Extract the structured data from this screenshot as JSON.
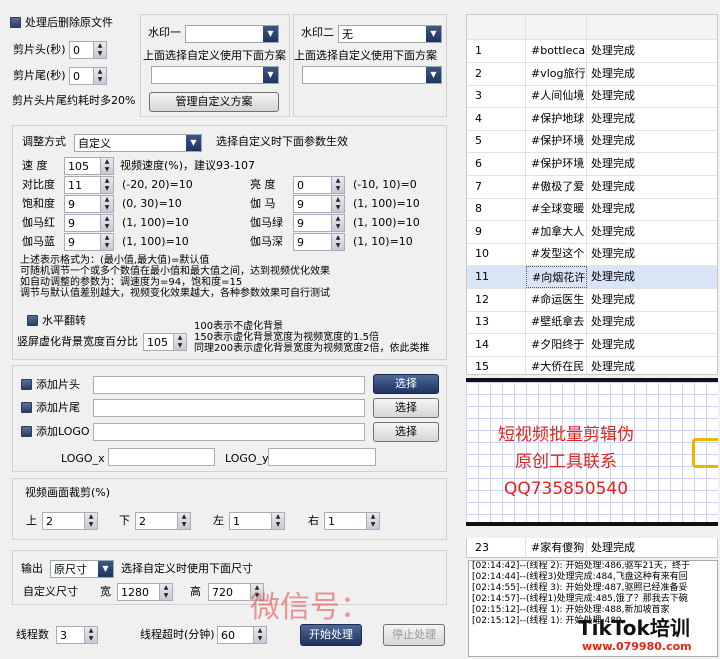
{
  "options": {
    "delete_original_label": "处理后删除原文件",
    "trim_head_label": "剪片头(秒)",
    "trim_head_value": "0",
    "trim_tail_label": "剪片尾(秒)",
    "trim_tail_value": "0",
    "trim_note": "剪片头片尾约耗时多20%"
  },
  "watermark1": {
    "label": "水印一",
    "value": "",
    "hint": "上面选择自定义使用下面方案",
    "scheme_value": "",
    "manage_button": "管理自定义方案"
  },
  "watermark2": {
    "label": "水印二",
    "value": "无",
    "hint": "上面选择自定义使用下面方案",
    "scheme_value": ""
  },
  "adjust": {
    "mode_label": "调整方式",
    "mode_value": "自定义",
    "mode_hint": "选择自定义时下面参数生效",
    "speed_label": "速  度",
    "speed_value": "105",
    "speed_hint": "视频速度(%)，建议93-107",
    "contrast_label": "对比度",
    "contrast_value": "11",
    "contrast_range": "(-20, 20)=10",
    "brightness_label": "亮  度",
    "brightness_value": "0",
    "brightness_range": "(-10, 10)=0",
    "saturation_label": "饱和度",
    "saturation_value": "9",
    "saturation_range": "(0, 30)=10",
    "gamma_label": "伽  马",
    "gamma_value": "9",
    "gamma_range": "(1, 100)=10",
    "gamma_red_label": "伽马红",
    "gamma_red_value": "9",
    "gamma_red_range": "(1, 100)=10",
    "gamma_green_label": "伽马绿",
    "gamma_green_value": "9",
    "gamma_green_range": "(1, 100)=10",
    "gamma_blue_label": "伽马蓝",
    "gamma_blue_value": "9",
    "gamma_blue_range": "(1, 100)=10",
    "gamma_deep_label": "伽马深",
    "gamma_deep_value": "9",
    "gamma_deep_range": "(1, 10)=10",
    "notes": [
      "上述表示格式为：(最小值,最大值)=默认值",
      "可随机调节一个或多个数值在最小值和最大值之间，达到视频优化效果",
      "如自动调整的参数为：调速度为=94，饱和度=15",
      "调节与默认值差别越大，视频变化效果越大，各种参数效果可自行测试"
    ],
    "hflip_label": "水平翻转",
    "vblur_label": "竖屏虚化背景宽度百分比",
    "vblur_value": "105",
    "vblur_notes": [
      "100表示不虚化背景",
      "150表示虚化背景宽度为视频宽度的1.5倍",
      "同理200表示虚化背景宽度为视频宽度2倍，依此类推"
    ]
  },
  "attach": {
    "intro_label": "添加片头",
    "outro_label": "添加片尾",
    "logo_label": "添加LOGO",
    "choose_label": "选择",
    "logo_x_label": "LOGO_x",
    "logo_y_label": "LOGO_y"
  },
  "crop": {
    "title": "视频画面裁剪(%)",
    "top_label": "上",
    "top_value": "2",
    "bottom_label": "下",
    "bottom_value": "2",
    "left_label": "左",
    "left_value": "1",
    "right_label": "右",
    "right_value": "1"
  },
  "output": {
    "label": "输出",
    "value": "原尺寸",
    "hint": "选择自定义时使用下面尺寸",
    "custom_label": "自定义尺寸",
    "width_label": "宽",
    "width_value": "1280",
    "height_label": "高",
    "height_value": "720"
  },
  "run": {
    "threads_label": "线程数",
    "threads_value": "3",
    "timeout_label": "线程超时(分钟)",
    "timeout_value": "60",
    "start_button": "开始处理",
    "stop_button": "停止处理"
  },
  "table": {
    "rows": [
      {
        "n": "1",
        "name": "#bottlecapc",
        "status": "处理完成"
      },
      {
        "n": "2",
        "name": "#vlog旅行记",
        "status": "处理完成"
      },
      {
        "n": "3",
        "name": "#人间仙境",
        "status": "处理完成"
      },
      {
        "n": "4",
        "name": "#保护地球",
        "status": "处理完成"
      },
      {
        "n": "5",
        "name": "#保护环境",
        "status": "处理完成"
      },
      {
        "n": "6",
        "name": "#保护环境",
        "status": "处理完成"
      },
      {
        "n": "7",
        "name": "#傲极了爱",
        "status": "处理完成"
      },
      {
        "n": "8",
        "name": "#全球变暖",
        "status": "处理完成"
      },
      {
        "n": "9",
        "name": "#加拿大人",
        "status": "处理完成"
      },
      {
        "n": "10",
        "name": "#发型这个",
        "status": "处理完成"
      },
      {
        "n": "11",
        "name": "#向烟花许",
        "status": "处理完成"
      },
      {
        "n": "12",
        "name": "#命运医生",
        "status": "处理完成"
      },
      {
        "n": "13",
        "name": "#壁纸拿去",
        "status": "处理完成"
      },
      {
        "n": "14",
        "name": "#夕阳终于",
        "status": "处理完成"
      },
      {
        "n": "15",
        "name": "#大侨在民",
        "status": "处理完成"
      }
    ],
    "bottom_row": {
      "n": "23",
      "name": "#家有傻狗",
      "status": "处理完成"
    }
  },
  "ad": {
    "line1": "短视频批量剪辑伪",
    "line2": "原创工具联系",
    "line3": "QQ735850540"
  },
  "log": [
    "[02:14:42]--(线程 2): 开始处理:486,驱车21天，终于",
    "[02:14:44]--(线程3)处理完成:484,飞盘这种有来有回",
    "[02:14:55]--(线程 3): 开始处理:487,驱照已经准备妥",
    "[02:14:57]--(线程1)处理完成:485,饿了？那我去下碗",
    "[02:15:12]--(线程 1): 开始处理:488,新加坡首家",
    "[02:15:12]--(线程 1): 开始处理:489,"
  ],
  "watermarks": {
    "weixin": "微信号：",
    "tiktok": "TikTok培训",
    "site": "www.079980.com"
  }
}
